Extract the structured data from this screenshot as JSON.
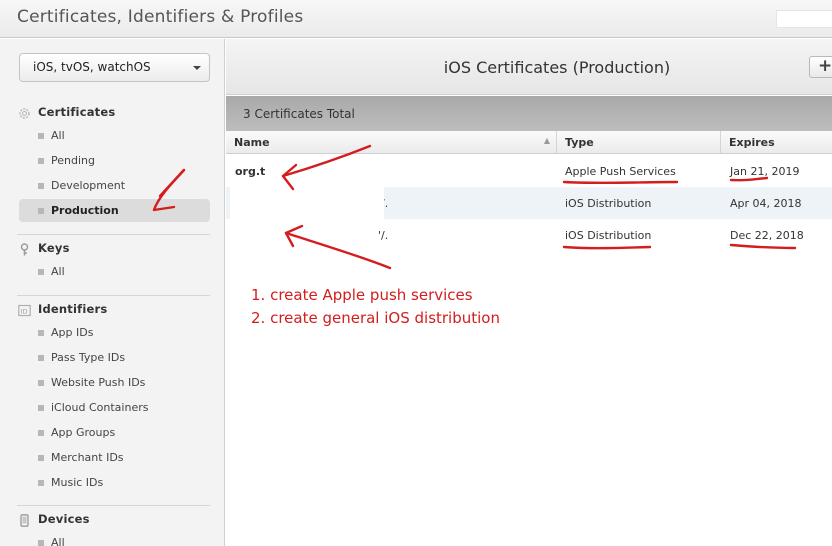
{
  "header": {
    "title": "Certificates, Identifiers & Profiles"
  },
  "sidebar": {
    "platform_select": "iOS, tvOS, watchOS",
    "sections": {
      "certificates": {
        "label": "Certificates",
        "icon": "gear-icon",
        "items": [
          "All",
          "Pending",
          "Development",
          "Production"
        ],
        "selected": "Production"
      },
      "keys": {
        "label": "Keys",
        "icon": "key-icon",
        "items": [
          "All"
        ]
      },
      "identifiers": {
        "label": "Identifiers",
        "icon": "id-icon",
        "items": [
          "App IDs",
          "Pass Type IDs",
          "Website Push IDs",
          "iCloud Containers",
          "App Groups",
          "Merchant IDs",
          "Music IDs"
        ]
      },
      "devices": {
        "label": "Devices",
        "icon": "device-icon",
        "items": [
          "All"
        ]
      }
    }
  },
  "main": {
    "title": "iOS Certificates (Production)",
    "add_label": "+",
    "total": "3 Certificates Total",
    "columns": {
      "name": "Name",
      "type": "Type",
      "expires": "Expires"
    },
    "rows": [
      {
        "name": "org.t",
        "type": "Apple Push Services",
        "expires": "Jan 21, 2019"
      },
      {
        "name": "'/.",
        "type": "iOS Distribution",
        "expires": "Apr 04, 2018"
      },
      {
        "name": "'/.",
        "type": "iOS Distribution",
        "expires": "Dec 22, 2018"
      }
    ]
  },
  "annotations": {
    "line1": "1. create Apple push services",
    "line2": "2. create general iOS distribution"
  },
  "colors": {
    "annotation_red": "#d41d1d",
    "alt_row": "#eef3f8"
  }
}
